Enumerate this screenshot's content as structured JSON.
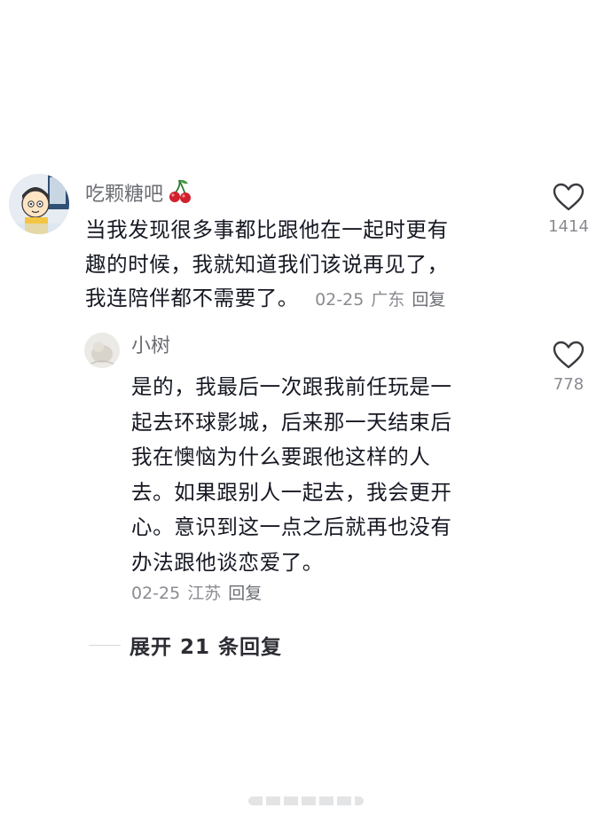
{
  "comments": [
    {
      "username": "吃颗糖吧",
      "username_emoji": "cherries-icon",
      "lines": [
        "当我发现很多事都比跟他在一起时更有",
        "趣的时候，我就知道我们该说再见了，",
        "我连陪伴都不需要了。"
      ],
      "date": "02-25",
      "location": "广东",
      "reply_label": "回复",
      "like_count": "1414"
    },
    {
      "username": "小树",
      "lines": [
        "是的，我最后一次跟我前任玩是一",
        "起去环球影城，后来那一天结束后",
        "我在懊恼为什么要跟他这样的人",
        "去。如果跟别人一起去，我会更开",
        "心。意识到这一点之后就再也没有",
        "办法跟他谈恋爱了。"
      ],
      "date": "02-25",
      "location": "江苏",
      "reply_label": "回复",
      "like_count": "778"
    }
  ],
  "expand_replies_label": "展开 21 条回复",
  "colors": {
    "text_primary": "#161823",
    "text_secondary": "#8a8b91",
    "username": "#6b6d73",
    "cherry_red": "#d0212e"
  }
}
